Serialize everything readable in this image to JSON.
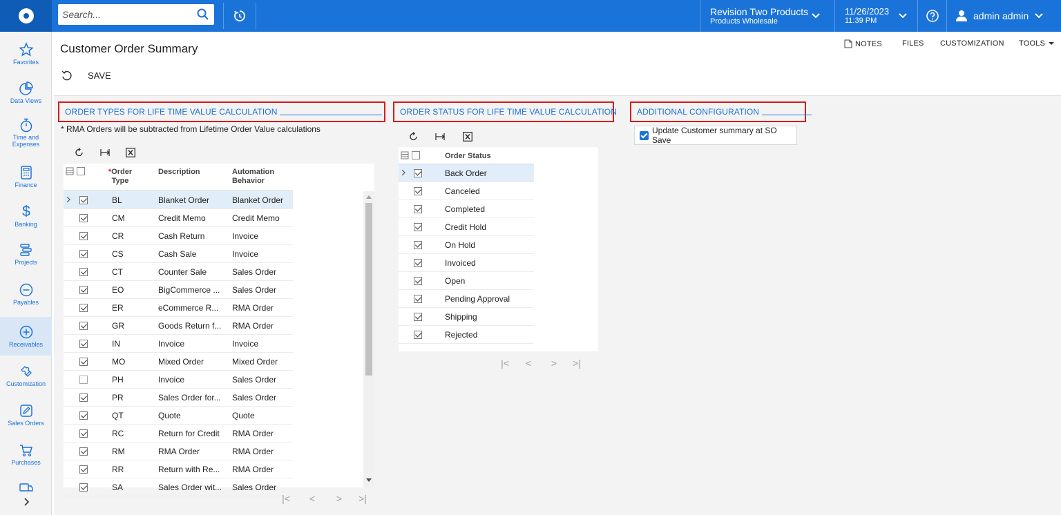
{
  "topbar": {
    "search_placeholder": "Search...",
    "company_name": "Revision Two Products",
    "company_branch": "Products Wholesale",
    "date": "11/26/2023",
    "time": "11:39 PM",
    "user_name": "admin admin"
  },
  "sidebar": {
    "items": [
      {
        "label": "Favorites",
        "icon": "star-icon"
      },
      {
        "label": "Data Views",
        "icon": "pie-chart-icon"
      },
      {
        "label": "Time and Expenses",
        "icon": "stopwatch-icon"
      },
      {
        "label": "Finance",
        "icon": "calculator-icon"
      },
      {
        "label": "Banking",
        "icon": "dollar-icon"
      },
      {
        "label": "Projects",
        "icon": "projects-icon"
      },
      {
        "label": "Payables",
        "icon": "minus-circle-icon"
      },
      {
        "label": "Receivables",
        "icon": "plus-circle-icon"
      },
      {
        "label": "Customization",
        "icon": "puzzle-icon"
      },
      {
        "label": "Sales Orders",
        "icon": "edit-icon"
      },
      {
        "label": "Purchases",
        "icon": "cart-icon"
      },
      {
        "label": "",
        "icon": "truck-icon"
      }
    ],
    "active_item": "Receivables"
  },
  "header": {
    "title": "Customer Order Summary",
    "links": {
      "notes": "NOTES",
      "files": "FILES",
      "customization": "CUSTOMIZATION",
      "tools": "TOOLS"
    },
    "save_label": "SAVE"
  },
  "order_types": {
    "section_title": "ORDER TYPES FOR LIFE TIME VALUE CALCULATION",
    "note": "* RMA Orders will be subtracted from Lifetime Order Value calculations",
    "columns": {
      "required_mark": "*",
      "order_type_1": "Order",
      "order_type_2": "Type",
      "description": "Description",
      "behavior_1": "Automation",
      "behavior_2": "Behavior"
    },
    "rows": [
      {
        "checked": true,
        "type": "BL",
        "description": "Blanket Order",
        "behavior": "Blanket Order"
      },
      {
        "checked": true,
        "type": "CM",
        "description": "Credit Memo",
        "behavior": "Credit Memo"
      },
      {
        "checked": true,
        "type": "CR",
        "description": "Cash Return",
        "behavior": "Invoice"
      },
      {
        "checked": true,
        "type": "CS",
        "description": "Cash Sale",
        "behavior": "Invoice"
      },
      {
        "checked": true,
        "type": "CT",
        "description": "Counter Sale",
        "behavior": "Sales Order"
      },
      {
        "checked": true,
        "type": "EO",
        "description": "BigCommerce ...",
        "behavior": "Sales Order"
      },
      {
        "checked": true,
        "type": "ER",
        "description": "eCommerce R...",
        "behavior": "RMA Order"
      },
      {
        "checked": true,
        "type": "GR",
        "description": "Goods Return f...",
        "behavior": "RMA Order"
      },
      {
        "checked": true,
        "type": "IN",
        "description": "Invoice",
        "behavior": "Invoice"
      },
      {
        "checked": true,
        "type": "MO",
        "description": "Mixed Order",
        "behavior": "Mixed Order"
      },
      {
        "checked": false,
        "type": "PH",
        "description": "Invoice",
        "behavior": "Sales Order"
      },
      {
        "checked": true,
        "type": "PR",
        "description": "Sales Order for...",
        "behavior": "Sales Order"
      },
      {
        "checked": true,
        "type": "QT",
        "description": "Quote",
        "behavior": "Quote"
      },
      {
        "checked": true,
        "type": "RC",
        "description": "Return for Credit",
        "behavior": "RMA Order"
      },
      {
        "checked": true,
        "type": "RM",
        "description": "RMA Order",
        "behavior": "RMA Order"
      },
      {
        "checked": true,
        "type": "RR",
        "description": "Return with Re...",
        "behavior": "RMA Order"
      },
      {
        "checked": true,
        "type": "SA",
        "description": "Sales Order wit...",
        "behavior": "Sales Order"
      }
    ]
  },
  "order_status": {
    "section_title": "ORDER STATUS FOR LIFE TIME VALUE CALCULATION",
    "columns": {
      "status": "Order Status"
    },
    "rows": [
      {
        "checked": true,
        "status": "Back Order"
      },
      {
        "checked": true,
        "status": "Canceled"
      },
      {
        "checked": true,
        "status": "Completed"
      },
      {
        "checked": true,
        "status": "Credit Hold"
      },
      {
        "checked": true,
        "status": "On Hold"
      },
      {
        "checked": true,
        "status": "Invoiced"
      },
      {
        "checked": true,
        "status": "Open"
      },
      {
        "checked": true,
        "status": "Pending Approval"
      },
      {
        "checked": true,
        "status": "Shipping"
      },
      {
        "checked": true,
        "status": "Rejected"
      }
    ]
  },
  "additional_config": {
    "section_title": "ADDITIONAL CONFIGURATION",
    "update_summary_label": "Update Customer summary at SO Save",
    "update_summary_checked": true
  },
  "colors": {
    "topbar": "#1a73d9",
    "accent": "#1a73d9",
    "highlight_border": "#d21c1c",
    "selected_row": "#e1edf9"
  }
}
